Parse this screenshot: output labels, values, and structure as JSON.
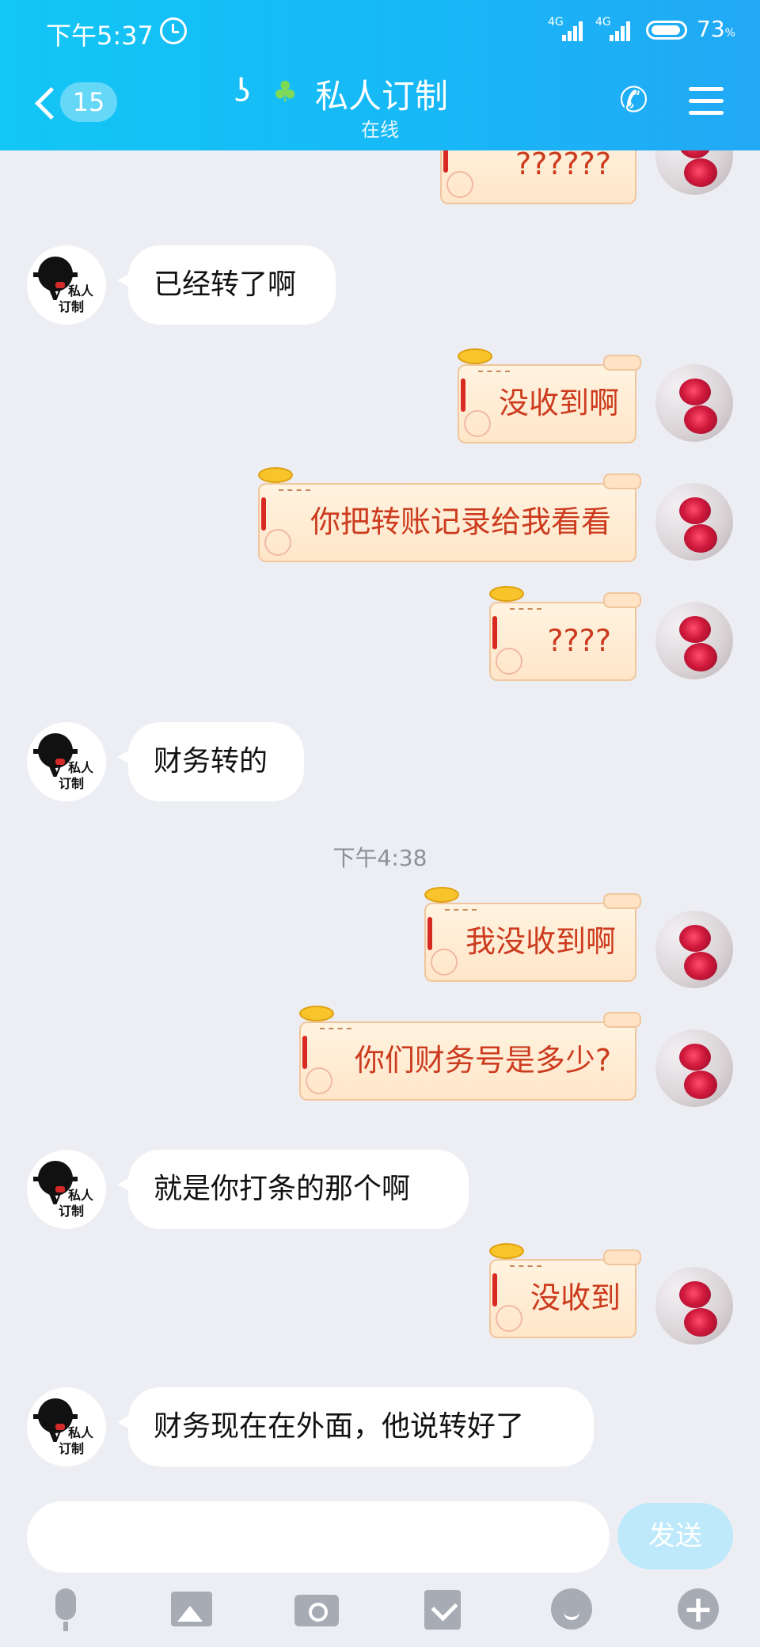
{
  "status_bar": {
    "time": "下午5:37",
    "net1": "4G",
    "net2": "4G",
    "battery": "73",
    "battery_unit": "%"
  },
  "header": {
    "unread_count": "15",
    "title": "私人订制",
    "subtitle": "在线",
    "ear_icon": "ear-icon",
    "sprout_icon": "sprout-icon"
  },
  "contact_avatar": {
    "line1": "私人",
    "line2": "订制"
  },
  "messages": [
    {
      "side": "right",
      "text": "??????"
    },
    {
      "side": "left",
      "text": "已经转了啊"
    },
    {
      "side": "right",
      "text": "没收到啊"
    },
    {
      "side": "right",
      "text": "你把转账记录给我看看"
    },
    {
      "side": "right",
      "text": "????"
    },
    {
      "side": "left",
      "text": "财务转的"
    },
    {
      "side": "time",
      "text": "下午4:38"
    },
    {
      "side": "right",
      "text": "我没收到啊"
    },
    {
      "side": "right",
      "text": "你们财务号是多少?"
    },
    {
      "side": "left",
      "text": "就是你打条的那个啊"
    },
    {
      "side": "right",
      "text": "没收到"
    },
    {
      "side": "left",
      "text": "财务现在在外面，他说转好了"
    }
  ],
  "input": {
    "placeholder": "",
    "send_label": "发送"
  },
  "toolbar": [
    "mic-icon",
    "image-icon",
    "camera-icon",
    "red-packet-icon",
    "emoji-icon",
    "plus-icon"
  ],
  "colors": {
    "header_start": "#12c6f5",
    "header_end": "#22a8f5",
    "send_button": "#bde9fb",
    "bubble_text": "#cc3b1e"
  }
}
